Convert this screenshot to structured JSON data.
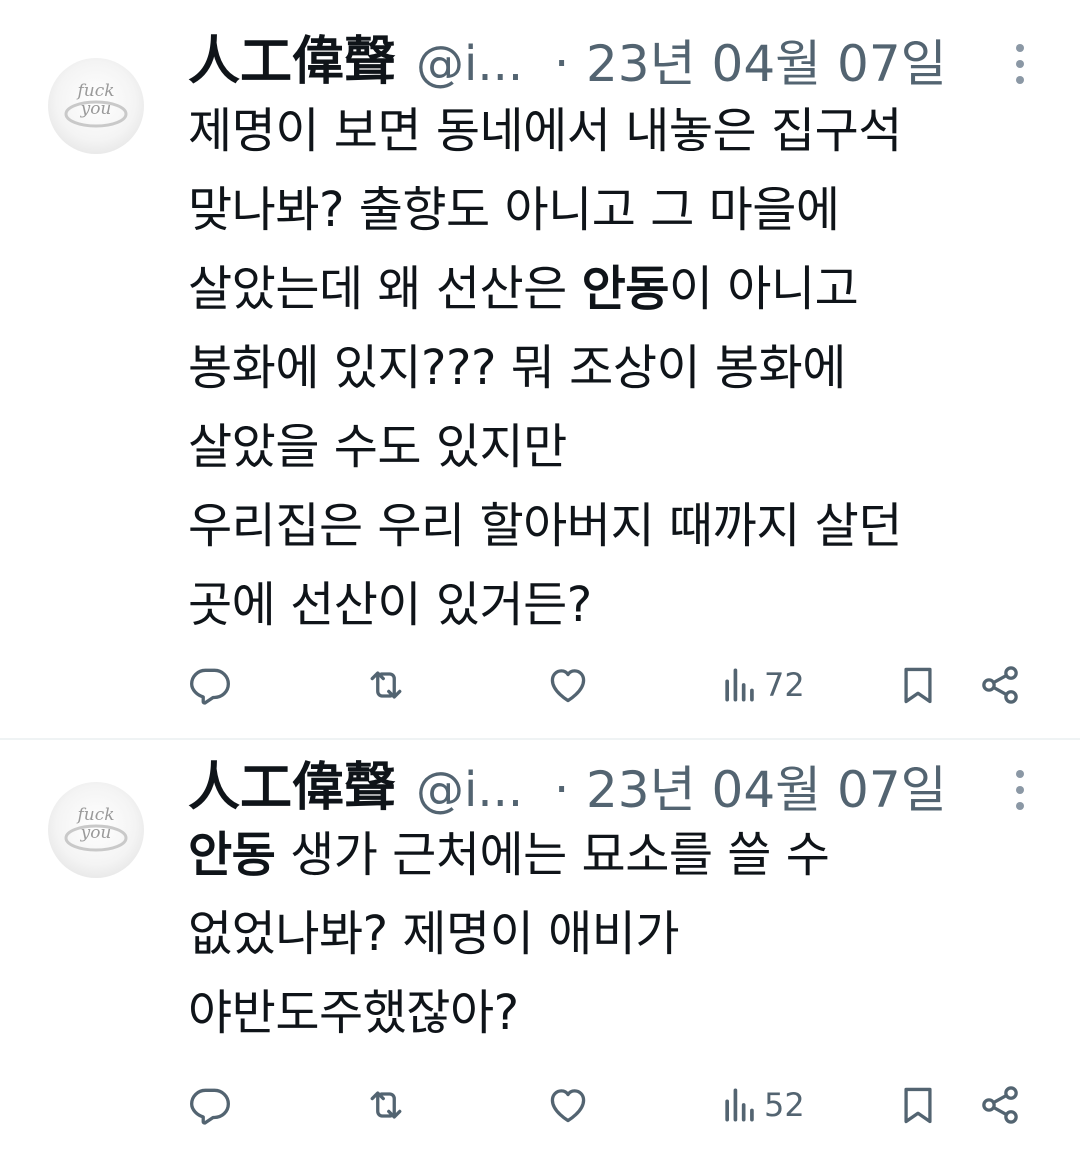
{
  "tweets": [
    {
      "display_name": "人工偉聲",
      "handle": "@i...",
      "separator": "·",
      "timestamp": "23년 04월 07일",
      "avatar_icon": "ring-avatar-icon",
      "lines": [
        "제명이 보면 동네에서 내놓은 집구석",
        "맞나봐? 출향도 아니고 그 마을에",
        "살았는데 왜 선산은 ",
        "봉화에 있지??? 뭐 조상이 봉화에",
        "살았을 수도 있지만",
        "우리집은 우리 할아버지 때까지 살던",
        "곳에 선산이 있거든?"
      ],
      "line3_bold": "안동",
      "line3_tail": "이 아니고",
      "views": "72"
    },
    {
      "display_name": "人工偉聲",
      "handle": "@i...",
      "separator": "·",
      "timestamp": "23년 04월 07일",
      "avatar_icon": "ring-avatar-icon",
      "line1_bold": "안동",
      "line1_tail": " 생가 근처에는 묘소를 쓸 수",
      "lines": [
        "",
        "없었나봐? 제명이 애비가",
        "야반도주했잖아?"
      ],
      "views": "52"
    }
  ],
  "icons": {
    "reply": "reply-icon",
    "retweet": "retweet-icon",
    "like": "heart-icon",
    "views": "views-chart-icon",
    "bookmark": "bookmark-icon",
    "share": "share-icon",
    "more": "more-vertical-icon"
  },
  "colors": {
    "text": "#0f1419",
    "secondary": "#536471",
    "divider": "#eff3f4"
  }
}
